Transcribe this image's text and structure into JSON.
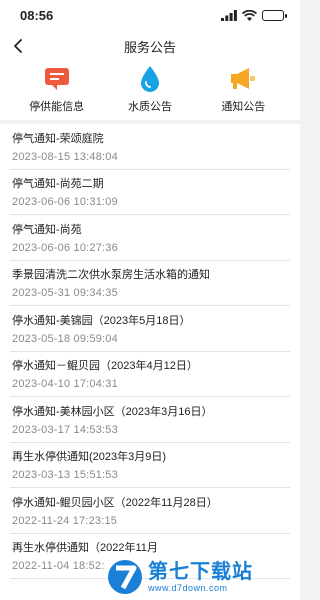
{
  "status_bar": {
    "time": "08:56"
  },
  "header": {
    "title": "服务公告"
  },
  "categories": [
    {
      "label": "停供能信息",
      "icon": "notice-message-icon",
      "color": "#ee5a3c"
    },
    {
      "label": "水质公告",
      "icon": "water-drop-icon",
      "color": "#1aa2e6"
    },
    {
      "label": "通知公告",
      "icon": "megaphone-icon",
      "color": "#f5a623"
    }
  ],
  "notices": [
    {
      "title": "停气通知-荣颂庭院",
      "date": "2023-08-15 13:48:04"
    },
    {
      "title": "停气通知-尚苑二期",
      "date": "2023-06-06 10:31:09"
    },
    {
      "title": "停气通知-尚苑",
      "date": "2023-06-06 10:27:36"
    },
    {
      "title": "季景园清洗二次供水泵房生活水箱的通知",
      "date": "2023-05-31 09:34:35"
    },
    {
      "title": "停水通知-美锦园（2023年5月18日）",
      "date": "2023-05-18 09:59:04"
    },
    {
      "title": "停水通知－鲲贝园（2023年4月12日）",
      "date": "2023-04-10 17:04:31"
    },
    {
      "title": "停水通知-美林园小区（2023年3月16日）",
      "date": "2023-03-17 14:53:53"
    },
    {
      "title": "再生水停供通知(2023年3月9日)",
      "date": "2023-03-13 15:51:53"
    },
    {
      "title": "停水通知-鲲贝园小区（2022年11月28日）",
      "date": "2022-11-24 17:23:15"
    },
    {
      "title": "再生水停供通知（2022年11月",
      "date": "2022-11-04 18:52:"
    }
  ],
  "watermark": {
    "name": "第七下载站",
    "url": "www.d7down.com"
  }
}
